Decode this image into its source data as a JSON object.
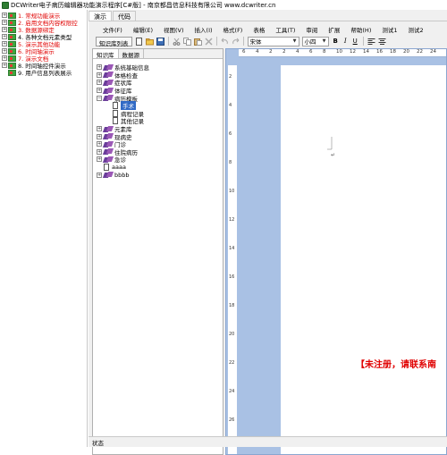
{
  "window": {
    "title": "DCWriter电子病历编辑器功能演示程序[C#版] - 南京都昌信息科技有限公司 www.dcwriter.cn"
  },
  "left_tree": {
    "items": [
      {
        "label": "1. 常规功能演示",
        "color": "red",
        "expander": "+"
      },
      {
        "label": "2. 启用文档内容权限控",
        "color": "red",
        "expander": "+"
      },
      {
        "label": "3. 数据源绑定",
        "color": "red",
        "expander": "+"
      },
      {
        "label": "4. 各种文档元素类型",
        "color": "black",
        "expander": "+"
      },
      {
        "label": "5. 演示其他功能",
        "color": "red",
        "expander": "+"
      },
      {
        "label": "6. 时间轴演示",
        "color": "red",
        "expander": "+"
      },
      {
        "label": "7. 演示文档",
        "color": "red",
        "expander": "+"
      },
      {
        "label": "8. 时间轴控件演示",
        "color": "black",
        "expander": "+"
      },
      {
        "label": "9. 用户信息列表展示",
        "color": "black",
        "expander": ""
      }
    ]
  },
  "top_tabs": [
    "演示",
    "代码"
  ],
  "menubar": [
    "文件(F)",
    "编辑(E)",
    "视图(V)",
    "插入(I)",
    "格式(F)",
    "表格",
    "工具(T)",
    "审阅",
    "扩展",
    "帮助(H)",
    "测试1",
    "测试2"
  ],
  "toolbar": {
    "kb_list_button": "知识库列表",
    "font_name": "宋体",
    "font_size": "小四",
    "bold": "B",
    "italic": "I",
    "underline": "U"
  },
  "kb_panel": {
    "tabs": [
      "知识库",
      "数据源"
    ],
    "tree": [
      {
        "label": "系统基础信息",
        "type": "folder",
        "indent": 0
      },
      {
        "label": "体格检查",
        "type": "folder",
        "indent": 0
      },
      {
        "label": "症状库",
        "type": "folder",
        "indent": 0
      },
      {
        "label": "体征库",
        "type": "folder",
        "indent": 0
      },
      {
        "label": "病历模板",
        "type": "folder-open",
        "indent": 0
      },
      {
        "label": "手术",
        "type": "doc-selected",
        "indent": 1
      },
      {
        "label": "病程记录",
        "type": "doc",
        "indent": 1
      },
      {
        "label": "其他记录",
        "type": "doc",
        "indent": 1
      },
      {
        "label": "元素库",
        "type": "folder",
        "indent": 0
      },
      {
        "label": "现病史",
        "type": "folder",
        "indent": 0
      },
      {
        "label": "门诊",
        "type": "folder",
        "indent": 0
      },
      {
        "label": "住院病历",
        "type": "folder",
        "indent": 0
      },
      {
        "label": "急诊",
        "type": "folder",
        "indent": 0
      },
      {
        "label": "aaaa",
        "type": "doc",
        "indent": 0
      },
      {
        "label": "bbbb",
        "type": "folder",
        "indent": 0
      }
    ]
  },
  "ruler": {
    "numbers": [
      "6",
      "4",
      "2",
      "2",
      "4",
      "6",
      "8",
      "10",
      "12",
      "14",
      "16",
      "18",
      "20",
      "22",
      "24"
    ],
    "vnumbers": [
      "2",
      "4",
      "6",
      "8",
      "10",
      "12",
      "14",
      "16",
      "18",
      "20",
      "22",
      "24",
      "26"
    ]
  },
  "document": {
    "watermark": "【未注册，请联系南"
  },
  "statusbar": {
    "text": "状态"
  }
}
